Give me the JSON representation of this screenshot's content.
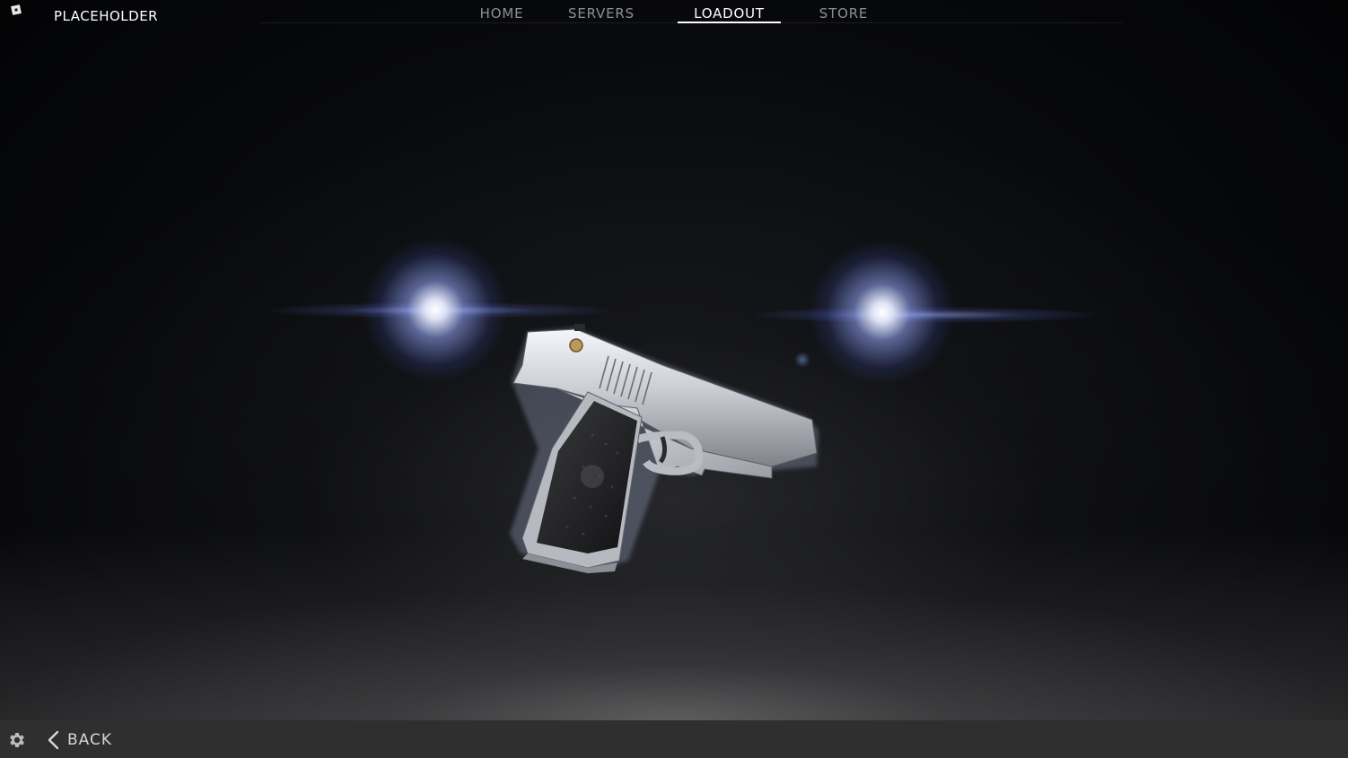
{
  "app": {
    "title": "PLACEHOLDER",
    "platform_icon": "roblox-icon"
  },
  "nav": {
    "tabs": [
      {
        "label": "HOME",
        "active": false
      },
      {
        "label": "SERVERS",
        "active": false
      },
      {
        "label": "LOADOUT",
        "active": true
      },
      {
        "label": "STORE",
        "active": false
      }
    ],
    "active_color": "#ffffff",
    "inactive_color": "#8c8f94"
  },
  "scene": {
    "item_icon": "pistol-model",
    "light_color": "#aab9ff",
    "background_color": "#07080a"
  },
  "footer": {
    "settings_icon": "gear-icon",
    "back_icon": "chevron-left-icon",
    "back_label": "BACK",
    "bar_color": "#2f2f2f"
  }
}
